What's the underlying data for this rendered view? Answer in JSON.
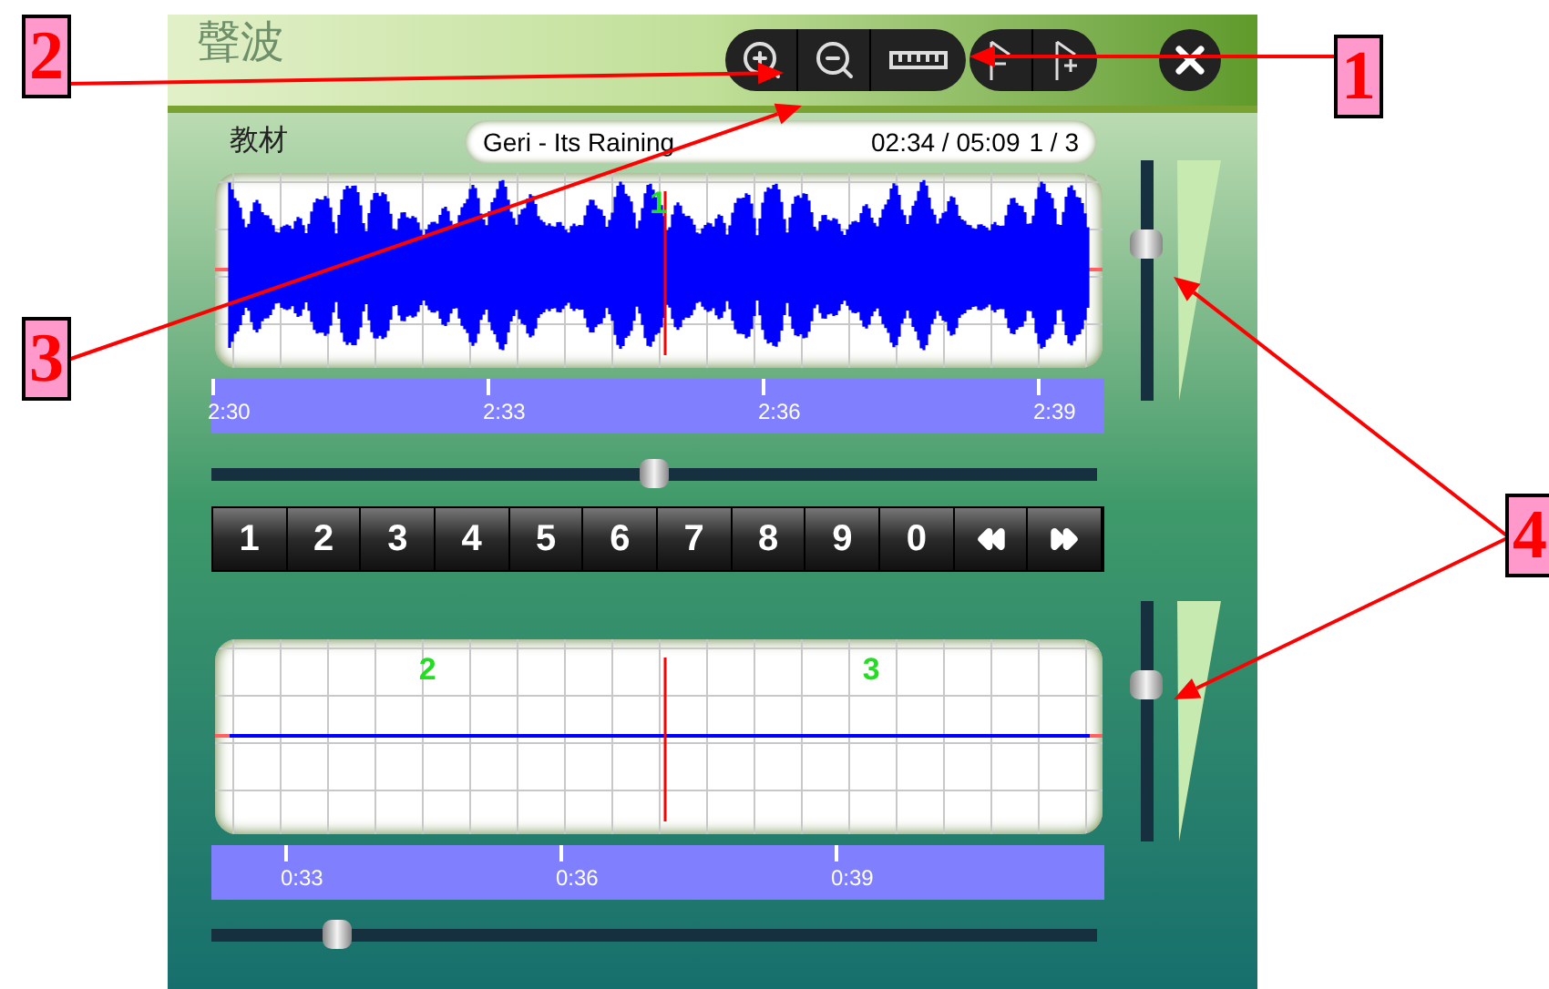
{
  "window": {
    "title": "聲波"
  },
  "track": {
    "label": "教材",
    "name": "Geri - Its Raining",
    "time": "02:34 / 05:09",
    "position": "1 / 3"
  },
  "upper_wave": {
    "markers": [
      "1"
    ],
    "ticks": [
      "2:30",
      "2:33",
      "2:36",
      "2:39"
    ],
    "kind": "signal"
  },
  "upper_scroll": {
    "level": 0.5
  },
  "upper_volume": {
    "level": 0.67
  },
  "keys": [
    "1",
    "2",
    "3",
    "4",
    "5",
    "6",
    "7",
    "8",
    "9",
    "0"
  ],
  "lower_wave": {
    "markers": [
      "2",
      "3"
    ],
    "ticks": [
      "0:33",
      "0:36",
      "0:39"
    ],
    "kind": "silent"
  },
  "lower_scroll": {
    "level": 0.13
  },
  "lower_volume": {
    "level": 0.67
  },
  "callouts": [
    {
      "label": "1"
    },
    {
      "label": "2"
    },
    {
      "label": "3"
    },
    {
      "label": "4"
    }
  ]
}
